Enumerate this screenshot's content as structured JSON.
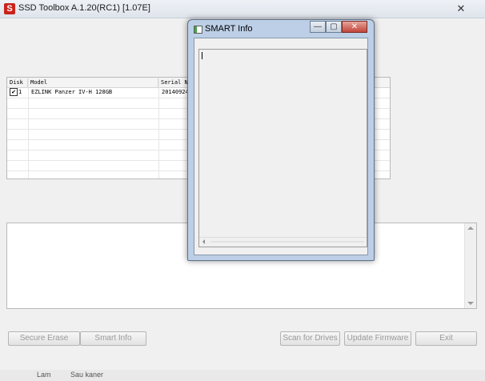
{
  "app": {
    "title": "SSD Toolbox A.1.20(RC1) [1.07E]",
    "logo_letter": "S",
    "close_glyph": "✕"
  },
  "disk_table": {
    "headers": [
      "Disk",
      "Model",
      "Serial N"
    ],
    "rows": [
      {
        "checked": true,
        "disk": "1",
        "model": "EZLINK Panzer IV-H 128GB",
        "serial": "20140924"
      }
    ],
    "check_glyph": "✔"
  },
  "buttons": {
    "secure_erase": "Secure Erase",
    "smart_info": "Smart Info",
    "scan_for_drives": "Scan for Drives",
    "update_firmware": "Update Firmware",
    "exit": "Exit"
  },
  "status_strip": {
    "left_text": "Lam",
    "right_text": "Sau kaner"
  },
  "smart_window": {
    "title": "SMART Info",
    "min_glyph": "—",
    "max_glyph": "▢",
    "close_glyph": "✕",
    "content": ""
  },
  "colors": {
    "accent_red": "#c8241c",
    "popup_frame": "#bccfe6",
    "close_button": "#c2443a"
  }
}
